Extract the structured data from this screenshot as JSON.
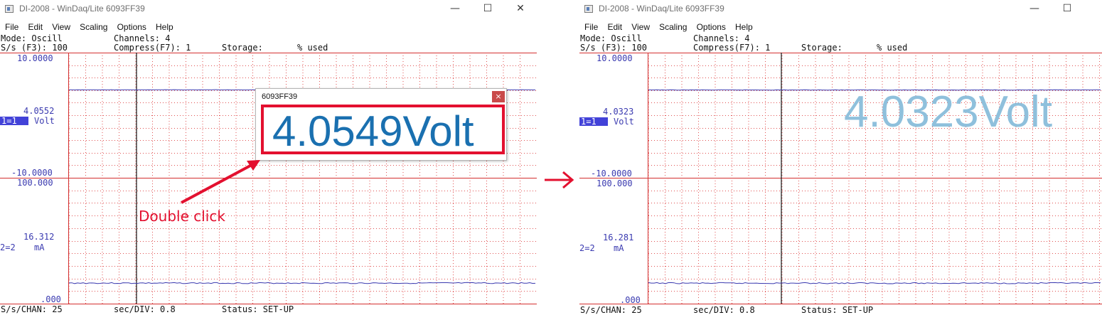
{
  "colors": {
    "grid_dot": "#e05050",
    "grid_line": "#d43030",
    "trace": "#3a3ab0",
    "annotation": "#e3102f",
    "readout_left": "#1a70b0",
    "readout_right": "#8fc0dc"
  },
  "icons": {
    "minimize": "minimize-icon",
    "maximize": "maximize-icon",
    "close": "close-icon",
    "arrow": "arrow-right-icon"
  },
  "windows": [
    {
      "title": "DI-2008 - WinDaq/Lite 6093FF39",
      "menu": [
        "File",
        "Edit",
        "View",
        "Scaling",
        "Options",
        "Help"
      ],
      "status_top": {
        "mode": "Mode: Oscill",
        "channels": "Channels: 4",
        "rate": "S/s (F3): 100",
        "compress": "Compress(F7): 1",
        "storage": "Storage:",
        "used": "% used"
      },
      "ch1": {
        "top": "10.0000",
        "value": "4.0552",
        "chan_label": "1=1",
        "unit": "Volt",
        "bottom": "-10.0000",
        "level": 4.0552,
        "range": [
          -10,
          10
        ]
      },
      "ch2": {
        "top": "100.000",
        "value": "16.312",
        "chan_label": "2=2",
        "unit": "mA",
        "bottom": ".000",
        "level": 16.312,
        "range": [
          0,
          100
        ]
      },
      "status_bottom": {
        "schan": "S/s/CHAN: 25",
        "secdiv": "sec/DIV: 0.8",
        "status": "Status: SET-UP"
      },
      "popup": {
        "title": "6093FF39",
        "close": "×",
        "reading": "4.0549Volt"
      },
      "annotation": "Double click"
    },
    {
      "title": "DI-2008 - WinDaq/Lite 6093FF39",
      "menu": [
        "File",
        "Edit",
        "View",
        "Scaling",
        "Options",
        "Help"
      ],
      "status_top": {
        "mode": "Mode: Oscill",
        "channels": "Channels: 4",
        "rate": "S/s (F3): 100",
        "compress": "Compress(F7): 1",
        "storage": "Storage:",
        "used": "% used"
      },
      "ch1": {
        "top": "10.0000",
        "value": "4.0323",
        "chan_label": "1=1",
        "unit": "Volt",
        "bottom": "-10.0000",
        "level": 4.0323,
        "range": [
          -10,
          10
        ]
      },
      "ch2": {
        "top": "100.000",
        "value": "16.281",
        "chan_label": "2=2",
        "unit": "mA",
        "bottom": ".000",
        "level": 16.281,
        "range": [
          0,
          100
        ]
      },
      "status_bottom": {
        "schan": "S/s/CHAN: 25",
        "secdiv": "sec/DIV: 0.8",
        "status": "Status: SET-UP"
      },
      "reading": "4.0323Volt"
    }
  ]
}
